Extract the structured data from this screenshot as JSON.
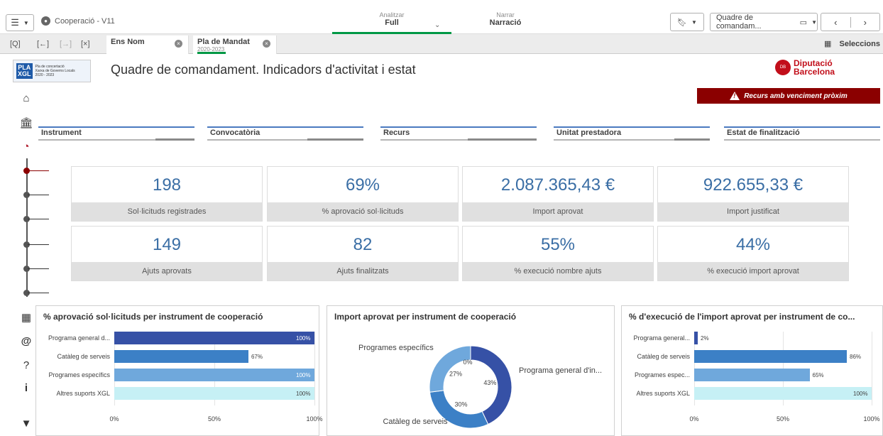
{
  "topbar": {
    "app_title": "Cooperació - V11",
    "analyze_label": "Analitzar",
    "analyze_value": "Full",
    "narrate_label": "Narrar",
    "narrate_value": "Narració",
    "sheet_name": "Quadre de comandam..."
  },
  "selbar": {
    "chips": [
      {
        "title": "Ens Nom",
        "sub": ""
      },
      {
        "title": "Pla de Mandat",
        "sub": "2020-2023"
      }
    ],
    "selections_label": "Seleccions"
  },
  "page": {
    "title": "Quadre de comandament. Indicadors d'activitat i estat",
    "alert": "Recurs amb venciment pròxim",
    "diba_line1": "Diputació",
    "diba_line2": "Barcelona",
    "logo_main": "PLA XGL",
    "logo_sub": "Pla de concertació Xarxa de Governs Locals 2020 - 2023"
  },
  "filters": [
    {
      "label": "Instrument",
      "progress": 0.5
    },
    {
      "label": "Convocatòria",
      "progress": 0.72
    },
    {
      "label": "Recurs",
      "progress": 0.88
    },
    {
      "label": "Unitat prestadora",
      "progress": 0.45
    },
    {
      "label": "Estat de finalització",
      "progress": 0
    }
  ],
  "kpis": [
    {
      "value": "198",
      "label": "Sol·licituds registrades"
    },
    {
      "value": "69%",
      "label": "% aprovació sol·licituds"
    },
    {
      "value": "2.087.365,43 €",
      "label": "Import aprovat"
    },
    {
      "value": "922.655,33 €",
      "label": "Import justificat"
    },
    {
      "value": "149",
      "label": "Ajuts aprovats"
    },
    {
      "value": "82",
      "label": "Ajuts finalitzats"
    },
    {
      "value": "55%",
      "label": "% execució nombre ajuts"
    },
    {
      "value": "44%",
      "label": "% execució import aprovat"
    }
  ],
  "colors": {
    "dark_blue": "#3651a6",
    "mid_blue": "#3c80c6",
    "light_blue": "#6fa8dc",
    "pale_cyan": "#c6f0f5",
    "accent_green": "#009845",
    "alert_red": "#8b0000"
  },
  "chart_data": [
    {
      "type": "bar",
      "title": "% aprovació sol·licituds per instrument de cooperació",
      "categories": [
        "Programa general d...",
        "Catàleg de serveis",
        "Programes específics",
        "Altres suports XGL"
      ],
      "values": [
        100,
        67,
        100,
        100
      ],
      "value_labels": [
        "100%",
        "67%",
        "100%",
        "100%"
      ],
      "ticks": [
        "0%",
        "50%",
        "100%"
      ],
      "xlim": [
        0,
        100
      ],
      "orientation": "horizontal"
    },
    {
      "type": "pie",
      "title": "Import aprovat per instrument de cooperació",
      "categories": [
        "Programa general d'in...",
        "Catàleg de serveis",
        "Programes específics",
        ""
      ],
      "values": [
        43,
        30,
        27,
        0
      ],
      "value_labels": [
        "43%",
        "30%",
        "27%",
        "0%"
      ],
      "donut": true
    },
    {
      "type": "bar",
      "title": "% d'execució de l'import aprovat per instrument de co...",
      "categories": [
        "Programa general...",
        "Catàleg de serveis",
        "Programes espec...",
        "Altres suports XGL"
      ],
      "values": [
        2,
        86,
        65,
        100
      ],
      "value_labels": [
        "2%",
        "86%",
        "65%",
        "100%"
      ],
      "ticks": [
        "0%",
        "50%",
        "100%"
      ],
      "xlim": [
        0,
        100
      ],
      "orientation": "horizontal"
    }
  ]
}
